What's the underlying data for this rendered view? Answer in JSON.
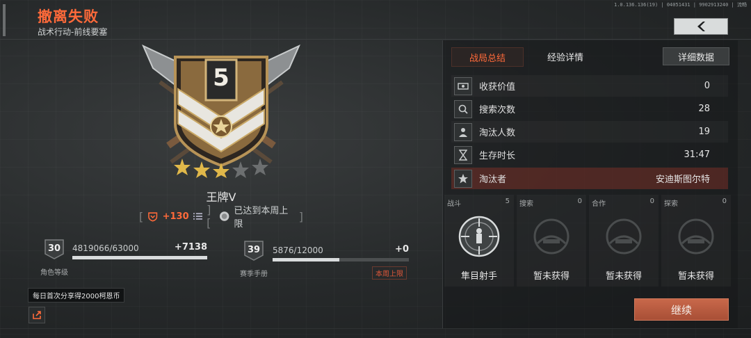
{
  "version_text": "1.0.136.136(19) | 04051431 | 9902913240 | 流畅",
  "header": {
    "title": "撤离失败",
    "subtitle": "战术行动-前线要塞"
  },
  "rank": {
    "badge_number": "5",
    "stars_filled": 3,
    "stars_total": 5,
    "name": "王牌V",
    "points_gain": "+130",
    "weekly_limit_text": "已达到本周上限"
  },
  "character_level": {
    "level": "30",
    "progress_text": "4819066/63000",
    "gain": "+7138",
    "label": "角色等级",
    "fill_fraction": 1.0
  },
  "season_pass": {
    "level": "39",
    "progress_text": "5876/12000",
    "gain": "+0",
    "label": "赛季手册",
    "weekly_limit_label": "本周上限",
    "fill_fraction": 0.49
  },
  "tooltip": "每日首次分享得2000柯恩币",
  "panel": {
    "tab_active": "战局总结",
    "tab_other": "经验详情",
    "detail_button": "详细数据",
    "stats": [
      {
        "icon": "cash-icon",
        "label": "收获价值",
        "value": "0"
      },
      {
        "icon": "search-icon",
        "label": "搜索次数",
        "value": "28"
      },
      {
        "icon": "elimination-icon",
        "label": "淘汰人数",
        "value": "19"
      },
      {
        "icon": "hourglass-icon",
        "label": "生存时长",
        "value": "31:47"
      },
      {
        "icon": "star-emblem-icon",
        "label": "淘汰者",
        "value": "安迪斯图尔特"
      }
    ],
    "categories": [
      {
        "title": "战斗",
        "count": "5",
        "label": "隼目射手"
      },
      {
        "title": "搜索",
        "count": "0",
        "label": "暂未获得"
      },
      {
        "title": "合作",
        "count": "0",
        "label": "暂未获得"
      },
      {
        "title": "探索",
        "count": "0",
        "label": "暂未获得"
      }
    ],
    "continue_button": "继续"
  },
  "colors": {
    "accent": "#ff6a3a",
    "killer_row": "#8c3228",
    "continue": "#b85a3f"
  }
}
